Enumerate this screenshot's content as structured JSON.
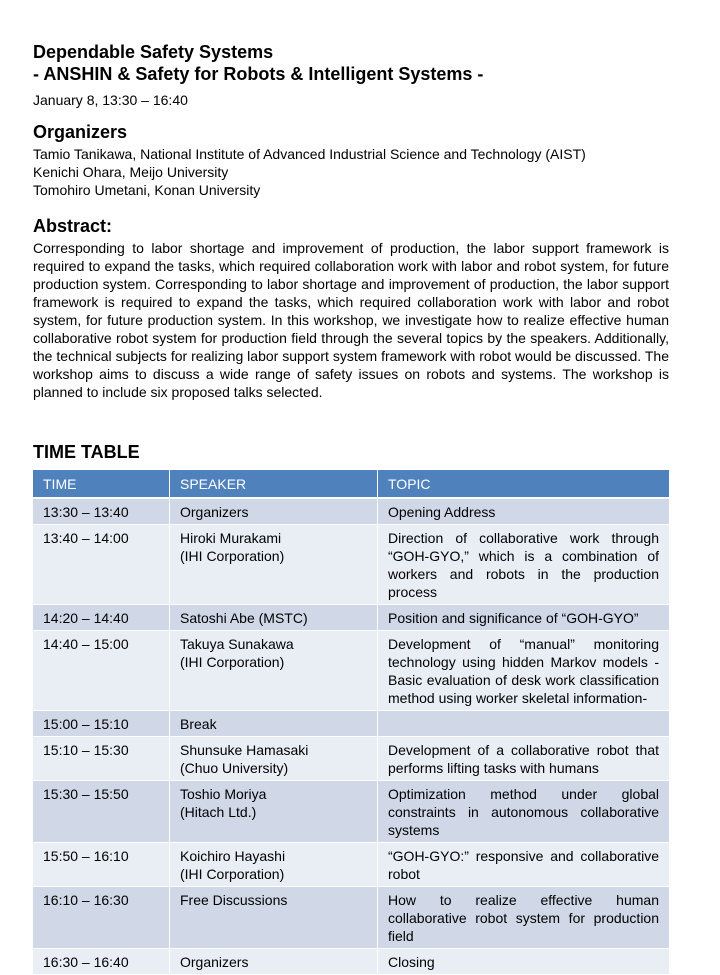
{
  "header": {
    "title_line1": "Dependable Safety Systems",
    "title_line2": "- ANSHIN & Safety for Robots & Intelligent Systems -",
    "date": "January 8, 13:30 – 16:40"
  },
  "organizers": {
    "heading": "Organizers",
    "list": [
      "Tamio Tanikawa, National Institute of Advanced Industrial Science and Technology (AIST)",
      "Kenichi Ohara, Meijo University",
      "Tomohiro Umetani, Konan University"
    ]
  },
  "abstract": {
    "heading": "Abstract:",
    "text": "Corresponding to labor shortage and improvement of production, the labor support framework is required to expand the tasks, which required collaboration work with labor and robot system, for future production system. Corresponding to labor shortage and improvement of production, the labor support framework is required to expand the tasks, which required collaboration work with labor and robot system, for future production system. In this workshop, we investigate how to realize effective human collaborative robot system for production field through the several topics by the speakers. Additionally, the technical subjects for realizing labor support system framework with robot would be discussed. The workshop aims to discuss a wide range of safety issues on robots and systems. The workshop is planned to include six proposed talks selected."
  },
  "timetable": {
    "heading": "TIME TABLE",
    "columns": [
      "TIME",
      "SPEAKER",
      "TOPIC"
    ],
    "rows": [
      {
        "time": "13:30 – 13:40",
        "speaker": [
          "Organizers"
        ],
        "topic": "Opening Address"
      },
      {
        "time": "13:40 – 14:00",
        "speaker": [
          "Hiroki Murakami",
          "(IHI Corporation)"
        ],
        "topic": "Direction of collaborative work through “GOH-GYO,” which is a combination of workers and robots in the production process"
      },
      {
        "time": "14:20 – 14:40",
        "speaker": [
          "Satoshi Abe (MSTC)"
        ],
        "topic": "Position and significance of “GOH-GYO”"
      },
      {
        "time": "14:40 – 15:00",
        "speaker": [
          "Takuya Sunakawa",
          "(IHI Corporation)"
        ],
        "topic": "Development of “manual” monitoring technology using hidden Markov models -Basic evaluation of desk work classification method using worker skeletal information-"
      },
      {
        "time": "15:00 – 15:10",
        "speaker": [
          "Break"
        ],
        "topic": ""
      },
      {
        "time": "15:10 – 15:30",
        "speaker": [
          "Shunsuke Hamasaki",
          "(Chuo University)"
        ],
        "topic": "Development of a collaborative robot that performs lifting tasks with humans"
      },
      {
        "time": "15:30 – 15:50",
        "speaker": [
          "Toshio Moriya",
          "(Hitach Ltd.)"
        ],
        "topic": "Optimization method under global constraints in autonomous collaborative systems"
      },
      {
        "time": "15:50 – 16:10",
        "speaker": [
          "Koichiro Hayashi",
          "(IHI Corporation)"
        ],
        "topic": "“GOH-GYO:” responsive and collaborative robot"
      },
      {
        "time": "16:10 – 16:30",
        "speaker": [
          "Free Discussions"
        ],
        "topic": "How to realize effective human collaborative robot system for production field"
      },
      {
        "time": "16:30 – 16:40",
        "speaker": [
          "Organizers"
        ],
        "topic": "Closing"
      }
    ]
  },
  "colors": {
    "header_blue": "#4f81bd",
    "row_dark": "#d0d8e8",
    "row_light": "#e9edf4"
  }
}
